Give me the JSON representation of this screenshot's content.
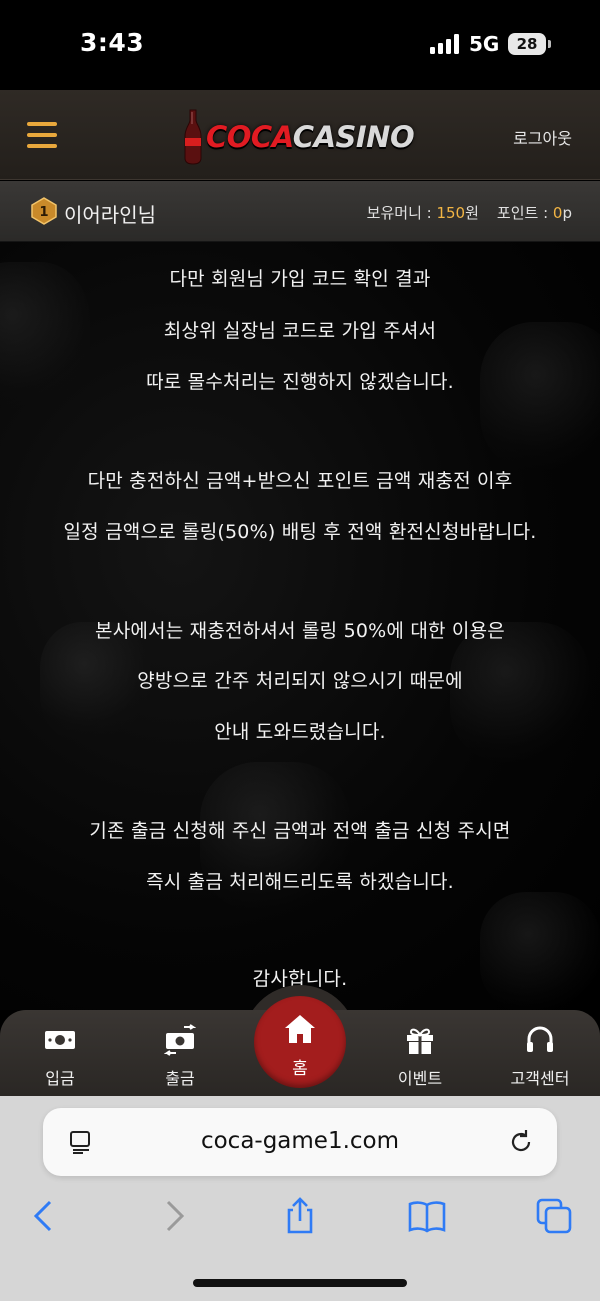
{
  "status_bar": {
    "time": "3:43",
    "network": "5G",
    "battery": "28"
  },
  "header": {
    "logo_coca": "COCA",
    "logo_casino": "CASINO",
    "logout": "로그아웃"
  },
  "user_bar": {
    "rank": "1",
    "username": "이어라인님",
    "money_label": "보유머니 : ",
    "money_value": "150",
    "money_unit": "원",
    "point_label": "포인트 : ",
    "point_value": "0",
    "point_unit": "p"
  },
  "message": {
    "lines": [
      "다만 회원님 가입 코드 확인 결과",
      "최상위 실장님 코드로 가입 주셔서",
      "따로 몰수처리는 진행하지 않겠습니다.",
      "다만 충전하신 금액+받으신 포인트 금액 재충전 이후",
      "일정 금액으로 롤링(50%) 배팅 후 전액 환전신청바랍니다.",
      "본사에서는 재충전하셔서 롤링 50%에 대한 이용은",
      "양방으로 간주 처리되지 않으시기 때문에",
      "안내 도와드렸습니다.",
      "기존 출금 신청해 주신 금액과 전액 출금 신청 주시면",
      "즉시 출금 처리해드리도록 하겠습니다.",
      "감사합니다."
    ]
  },
  "bottom_nav": {
    "deposit": "입금",
    "withdraw": "출금",
    "home": "홈",
    "event": "이벤트",
    "support": "고객센터"
  },
  "safari": {
    "url": "coca-game1.com"
  },
  "colors": {
    "accent_gold": "#f2b544",
    "home_red": "#a31d1d",
    "logo_red": "#e11b22"
  }
}
